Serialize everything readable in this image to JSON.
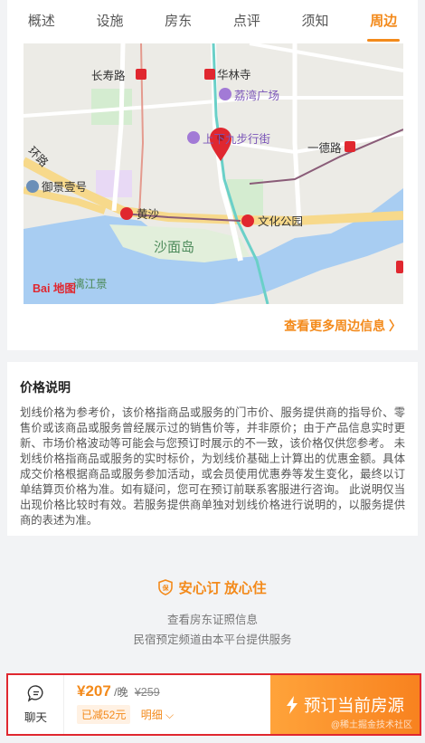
{
  "tabs": [
    {
      "label": "概述"
    },
    {
      "label": "设施"
    },
    {
      "label": "房东"
    },
    {
      "label": "点评"
    },
    {
      "label": "须知"
    },
    {
      "label": "周边"
    }
  ],
  "map": {
    "labels": {
      "changshou": "长寿路",
      "hualin": "华林寺",
      "liwan": "荔湾广场",
      "shangxiajiu": "上下九步行街",
      "yide": "一德路",
      "huanlu": "环路",
      "yujing": "御景壹号",
      "huangsha": "黄沙",
      "wenhua": "文化公园",
      "shamian": "沙面岛",
      "lijiang": "漓江景",
      "logo": "Bai 地图"
    },
    "colors": {
      "water": "#a8cdf2",
      "road": "#f7d98b",
      "metro": "#e0272f",
      "line": "#6ad0c8"
    }
  },
  "more_link": "查看更多周边信息 〉",
  "price_section": {
    "title": "价格说明",
    "body": "划线价格为参考价，该价格指商品或服务的门市价、服务提供商的指导价、零售价或该商品或服务曾经展示过的销售价等，并非原价；由于产品信息实时更新、市场价格波动等可能会与您预订时展示的不一致，该价格仅供您参考。 未划线价格指商品或服务的实时标价，为划线价基础上计算出的优惠金额。具体成交价格根据商品或服务参加活动，或会员使用优惠券等发生变化，最终以订单结算页价格为准。如有疑问，您可在预订前联系客服进行咨询。 此说明仅当出现价格比较时有效。若服务提供商单独对划线价格进行说明的，以服务提供商的表述为准。"
  },
  "assure": {
    "title": "安心订 放心住",
    "line1": "查看房东证照信息",
    "line2": "民宿预定频道由本平台提供服务"
  },
  "bottom": {
    "chat_label": "聊天",
    "price": "¥207",
    "per_night": "/晚",
    "old_price": "¥259",
    "discount": "已减52元",
    "detail": "明细",
    "book": "预订当前房源",
    "watermark": "@稀土掘金技术社区"
  }
}
